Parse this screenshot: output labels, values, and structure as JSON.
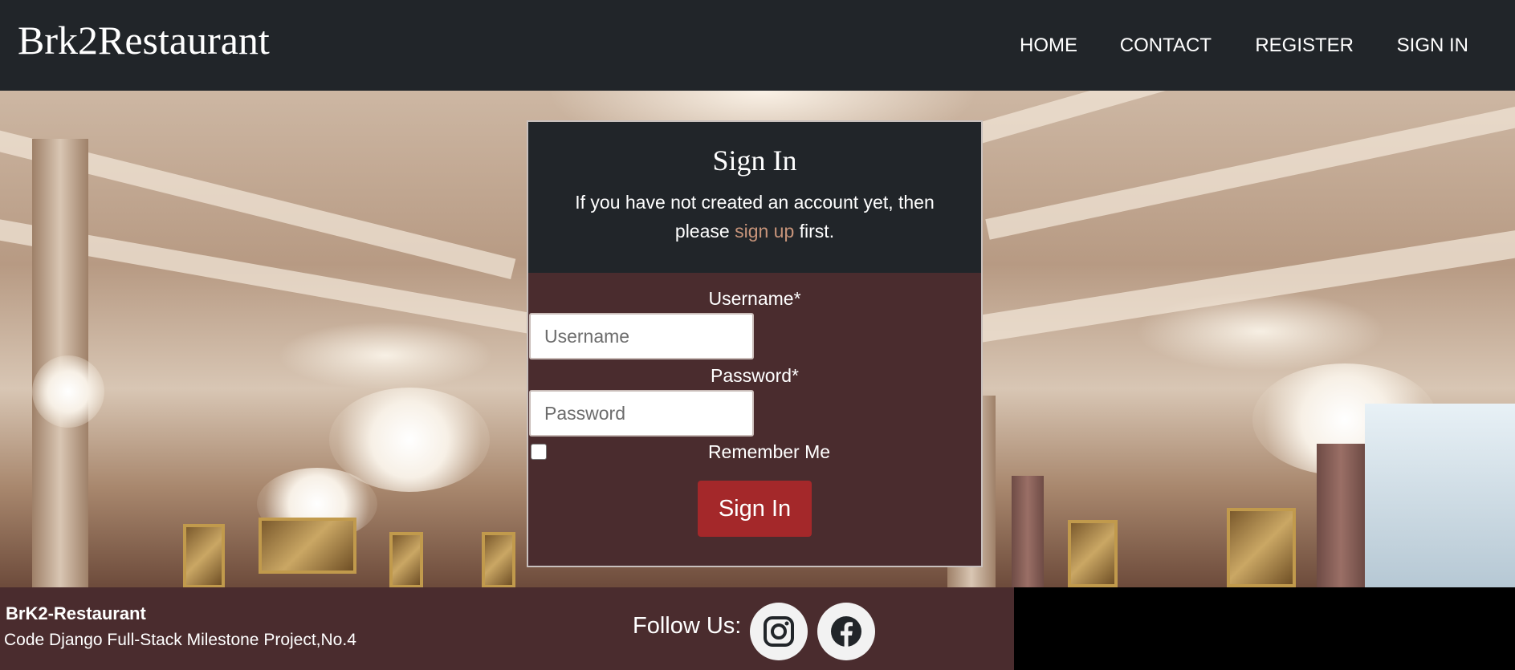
{
  "header": {
    "brand": "Brk2Restaurant",
    "nav": [
      {
        "label": "HOME"
      },
      {
        "label": "CONTACT"
      },
      {
        "label": "REGISTER"
      },
      {
        "label": "SIGN IN"
      }
    ]
  },
  "signin": {
    "title": "Sign In",
    "intro_before": "If you have not created an account yet, then please ",
    "intro_link": "sign up",
    "intro_after": " first.",
    "username_label": "Username*",
    "username_placeholder": "Username",
    "username_value": "",
    "password_label": "Password*",
    "password_placeholder": "Password",
    "password_value": "",
    "remember_label": "Remember Me",
    "remember_checked": false,
    "submit_label": "Sign In"
  },
  "footer": {
    "brand": "BrK2-Restaurant",
    "subtitle": "Code Django Full-Stack Milestone Project,No.4",
    "follow_label": "Follow Us:",
    "social": [
      {
        "icon": "instagram-icon"
      },
      {
        "icon": "facebook-icon"
      }
    ]
  },
  "colors": {
    "header_bg": "#212529",
    "card_body_bg": "#4a2c2e",
    "button_bg": "#a4282a",
    "link_color": "#c7947a",
    "footer_bg": "#4a2c2e"
  }
}
